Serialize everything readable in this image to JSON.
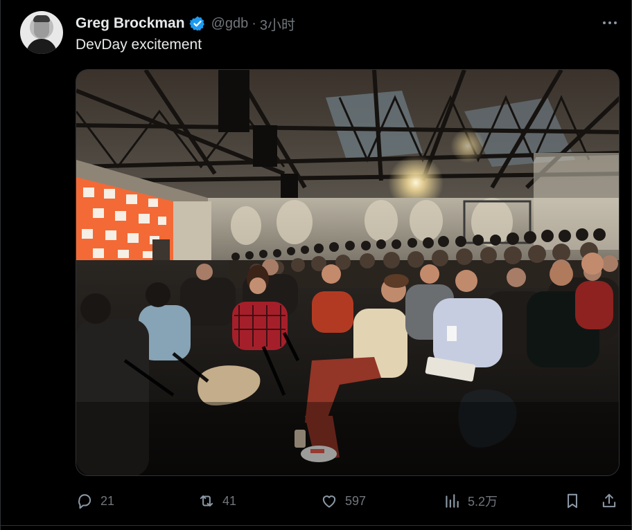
{
  "author": {
    "name": "Greg Brockman",
    "handle": "@gdb",
    "separator": "·",
    "time": "3小时",
    "verified": true
  },
  "tweet": {
    "text": "DevDay excitement"
  },
  "metrics": {
    "replies": "21",
    "reposts": "41",
    "likes": "597",
    "views": "5.2万"
  },
  "icons": {
    "more": "more-horizontal-icon",
    "reply": "reply-icon",
    "repost": "repost-icon",
    "like": "heart-icon",
    "views": "views-bar-chart-icon",
    "bookmark": "bookmark-icon",
    "share": "share-icon",
    "verified": "verified-badge-icon"
  },
  "colors": {
    "background": "#000000",
    "text_primary": "#e7e9ea",
    "text_secondary": "#71767b",
    "verified_blue": "#1d9bf0",
    "border": "#2f3336"
  }
}
